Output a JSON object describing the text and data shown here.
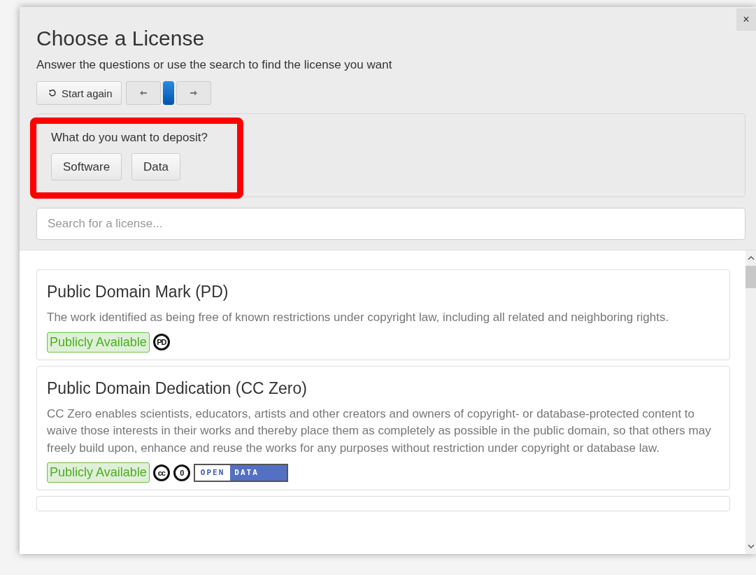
{
  "dialog": {
    "title": "Choose a License",
    "subtitle": "Answer the questions or use the search to find the license you want",
    "close_label": "×"
  },
  "nav": {
    "restart": "Start again"
  },
  "question": {
    "text": "What do you want to deposit?",
    "options": [
      "Software",
      "Data"
    ]
  },
  "search": {
    "placeholder": "Search for a license..."
  },
  "licenses": [
    {
      "title": "Public Domain Mark (PD)",
      "description": "The work identified as being free of known restrictions under copyright law, including all related and neighboring rights.",
      "availability": "Publicly Available",
      "marks": [
        {
          "kind": "circle",
          "text": "PD"
        }
      ]
    },
    {
      "title": "Public Domain Dedication (CC Zero)",
      "description": "CC Zero enables scientists, educators, artists and other creators and owners of copyright- or database-protected content to waive those interests in their works and thereby place them as completely as possible in the public domain, so that others may freely build upon, enhance and reuse the works for any purposes without restriction under copyright or database law.",
      "availability": "Publicly Available",
      "marks": [
        {
          "kind": "circle",
          "text": "cc"
        },
        {
          "kind": "circle",
          "text": "0"
        },
        {
          "kind": "banner",
          "parts": [
            "OPEN",
            "DATA"
          ]
        }
      ]
    }
  ]
}
